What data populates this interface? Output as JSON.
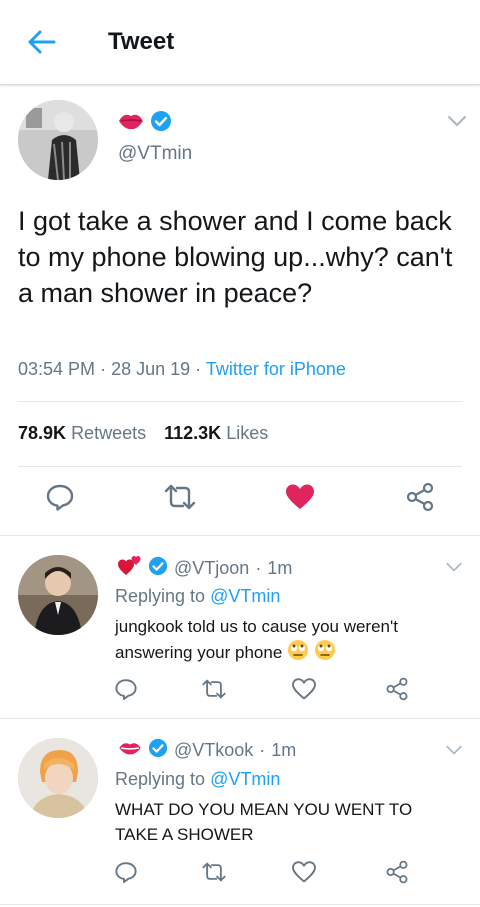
{
  "header": {
    "title": "Tweet"
  },
  "tweet": {
    "handle": "@VTmin",
    "text": "I got take a shower and I come back to my phone blowing up...why? can't a man shower in peace?",
    "time": "03:54 PM",
    "date": "28 Jun 19",
    "separator": "·",
    "source": "Twitter for iPhone",
    "retweets_count": "78.9K",
    "retweets_label": "Retweets",
    "likes_count": "112.3K",
    "likes_label": "Likes",
    "liked": true
  },
  "replies": [
    {
      "handle": "@VTjoon",
      "time": "1m",
      "replying_prefix": "Replying to",
      "replying_to": "@VTmin",
      "text": "jungkook told us to cause you weren't answering your phone",
      "name_emoji": "two-hearts"
    },
    {
      "handle": "@VTkook",
      "time": "1m",
      "replying_prefix": "Replying to",
      "replying_to": "@VTmin",
      "text": "WHAT DO YOU MEAN YOU WENT TO TAKE A SHOWER",
      "name_emoji": "lips"
    }
  ],
  "colors": {
    "accent": "#1da1f2",
    "like_active": "#e0245e",
    "secondary_text": "#657786",
    "icon_gray": "#657786"
  }
}
